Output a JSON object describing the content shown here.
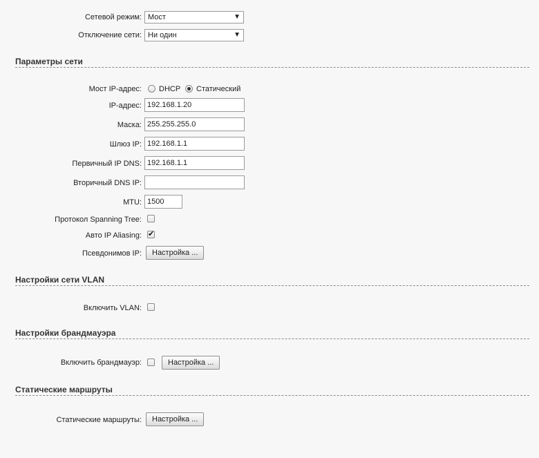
{
  "mode_rows": {
    "network_mode": {
      "label": "Сетевой режим:",
      "value": "Мост"
    },
    "network_disconnect": {
      "label": "Отключение сети:",
      "value": "Ни один"
    }
  },
  "network_params": {
    "title": "Параметры сети",
    "bridge_ip": {
      "label": "Мост IP-адрес:",
      "option_dhcp": "DHCP",
      "option_static": "Статический",
      "selected": "Статический"
    },
    "ip": {
      "label": "IP-адрес:",
      "value": "192.168.1.20"
    },
    "mask": {
      "label": "Маска:",
      "value": "255.255.255.0"
    },
    "gateway": {
      "label": "Шлюз IP:",
      "value": "192.168.1.1"
    },
    "dns1": {
      "label": "Первичный IP DNS:",
      "value": "192.168.1.1"
    },
    "dns2": {
      "label": "Вторичный DNS IP:",
      "value": ""
    },
    "mtu": {
      "label": "MTU:",
      "value": "1500"
    },
    "stp": {
      "label": "Протокол Spanning Tree:",
      "checked": false
    },
    "auto_alias": {
      "label": "Авто IP Aliasing:",
      "checked": true
    },
    "ip_aliases": {
      "label": "Псевдонимов IP:",
      "button": "Настройка ..."
    }
  },
  "vlan": {
    "title": "Настройки сети VLAN",
    "enable": {
      "label": "Включить VLAN:",
      "checked": false
    }
  },
  "firewall": {
    "title": "Настройки брандмауэра",
    "enable": {
      "label": "Включить брандмауэр:",
      "checked": false,
      "button": "Настройка ..."
    }
  },
  "routes": {
    "title": "Статические маршруты",
    "row": {
      "label": "Статические маршруты:",
      "button": "Настройка ..."
    }
  },
  "icons": {
    "dropdown_arrow": "▼",
    "check_mark": "✔"
  }
}
